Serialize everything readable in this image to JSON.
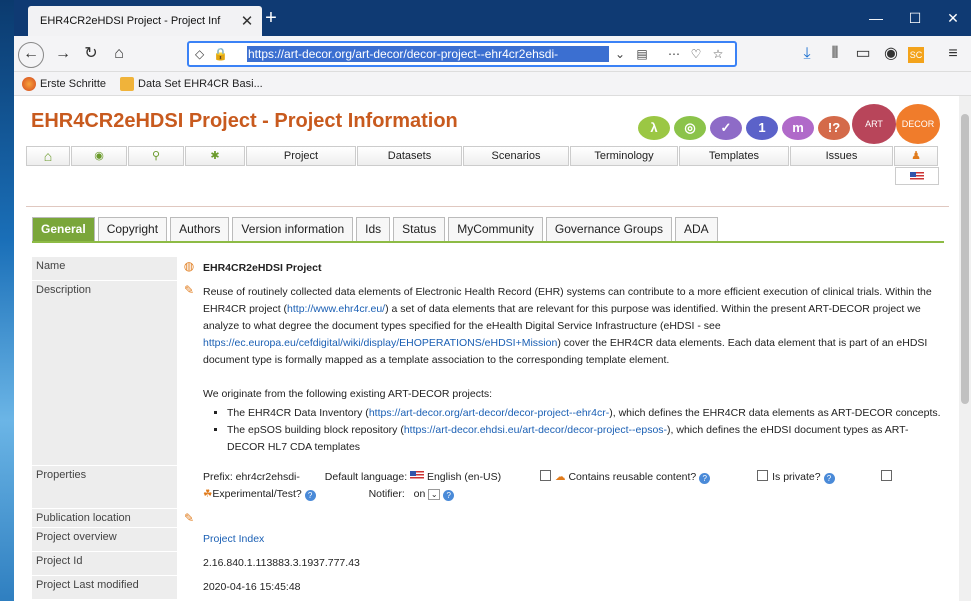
{
  "browser": {
    "tab_title": "EHR4CR2eHDSI Project - Project Inf",
    "tab_close": "✕",
    "new_tab": "+",
    "win_min": "—",
    "win_max": "☐",
    "win_close": "✕",
    "url": "https://art-decor.org/art-decor/decor-project--ehr4cr2ehsdi-",
    "bookmarks": [
      "Erste Schritte",
      "Data Set EHR4CR Basi..."
    ]
  },
  "page": {
    "title": "EHR4CR2eHDSI Project - Project Information",
    "logo_letters": [
      "λ",
      "◎",
      "✓",
      "1",
      "m",
      "!?"
    ],
    "logo_art": "ART",
    "logo_decor": "DECOR",
    "menu": [
      "Project",
      "Datasets",
      "Scenarios",
      "Terminology",
      "Templates",
      "Issues"
    ],
    "tabs": [
      "General",
      "Copyright",
      "Authors",
      "Version information",
      "Ids",
      "Status",
      "MyCommunity",
      "Governance Groups",
      "ADA"
    ],
    "labels": {
      "name": "Name",
      "description": "Description",
      "properties": "Properties",
      "publication": "Publication location",
      "overview": "Project overview",
      "project_id": "Project Id",
      "last_modified": "Project Last modified"
    },
    "name_value": "EHR4CR2eHDSI Project",
    "desc": {
      "p1a": "Reuse of routinely collected data elements of Electronic Health Record (EHR) systems can contribute to a more efficient execution of clinical trials. Within the  EHR4CR project (",
      "link1": "http://www.ehr4cr.eu/",
      "p1b": ") a set of data elements that are relevant for this purpose was identified. Within the present ART-DECOR project we analyze to what degree the document types specified for the eHealth Digital Service Infrastructure (eHDSI - see ",
      "link2": "https://ec.europa.eu/cefdigital/wiki/display/EHOPERATIONS/eHDSI+Mission",
      "p1c": ") cover the EHR4CR data elements. Each data element that is part of an eHDSI document type is formally mapped as a template association to the corresponding template element.",
      "p2": "We originate from the following existing ART-DECOR projects:",
      "li1a": "The EHR4CR Data Inventory (",
      "li1link": "https://art-decor.org/art-decor/decor-project--ehr4cr-",
      "li1b": "), which defines the EHR4CR data elements as ART-DECOR concepts.",
      "li2a": "The epSOS building block repository (",
      "li2link": "https://art-decor.ehdsi.eu/art-decor/decor-project--epsos-",
      "li2b": "), which defines the eHDSI document types as ART-DECOR HL7 CDA templates"
    },
    "props": {
      "prefix": "Prefix: ehr4cr2ehsdi-",
      "default_lang_label": "Default language:",
      "default_lang": "English (en-US)",
      "reusable": "Contains reusable content?",
      "private": "Is private?",
      "experimental": "Experimental/Test?",
      "notifier_label": "Notifier:",
      "notifier_value": "on"
    },
    "overview_link": "Project Index",
    "project_id": "2.16.840.1.113883.3.1937.777.43",
    "last_modified": "2020-04-16 15:45:48"
  },
  "colors": {
    "title": "#c85a1e",
    "tab_active": "#7aa63a",
    "tabbar": "#0f3a73"
  }
}
